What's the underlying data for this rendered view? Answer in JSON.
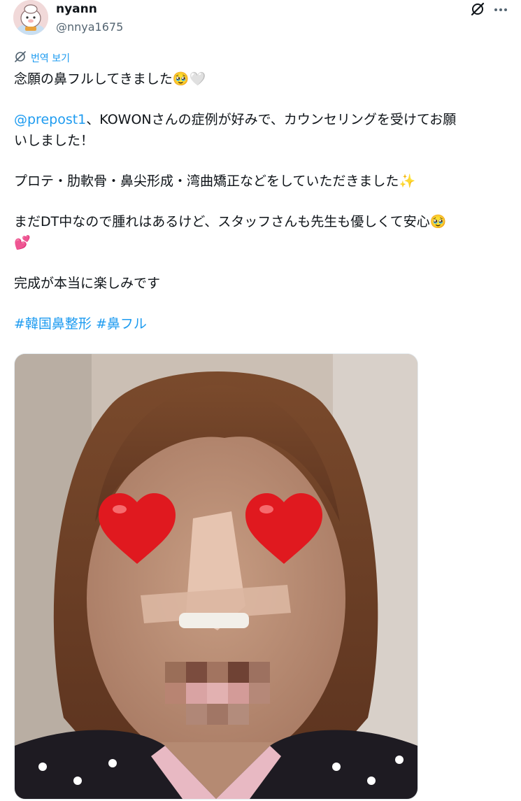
{
  "tweet": {
    "author_name": "nyann",
    "author_handle": "@nnya1675",
    "translate_label": "번역 보기",
    "line1_text": "念願の鼻フルしてきました",
    "line1_emoji1": "🥹",
    "line1_emoji2": "🤍",
    "mention": "@prepost1",
    "line2_text": "、KOWONさんの症例が好みで、カウンセリングを受けてお願",
    "line3_text": "いしました！",
    "line4_text": "プロテ・肋軟骨・鼻尖形成・湾曲矯正などをしていただきました",
    "line4_emoji": "✨",
    "line5_text": "まだDT中なので腫れはあるけど、スタッフさんも先生も優しくて安心",
    "line5_emoji": "🥹",
    "line6_emoji": "💕",
    "line7_text": "完成が本当に楽しみです",
    "hashtag1": "#韓国鼻整形",
    "hashtag2": "#鼻フル"
  },
  "icons": {
    "grok": "grok-icon",
    "more": "more-icon",
    "translate": "translate-icon"
  },
  "colors": {
    "link": "#1d9bf0",
    "text": "#0f1419",
    "secondary": "#536471"
  }
}
